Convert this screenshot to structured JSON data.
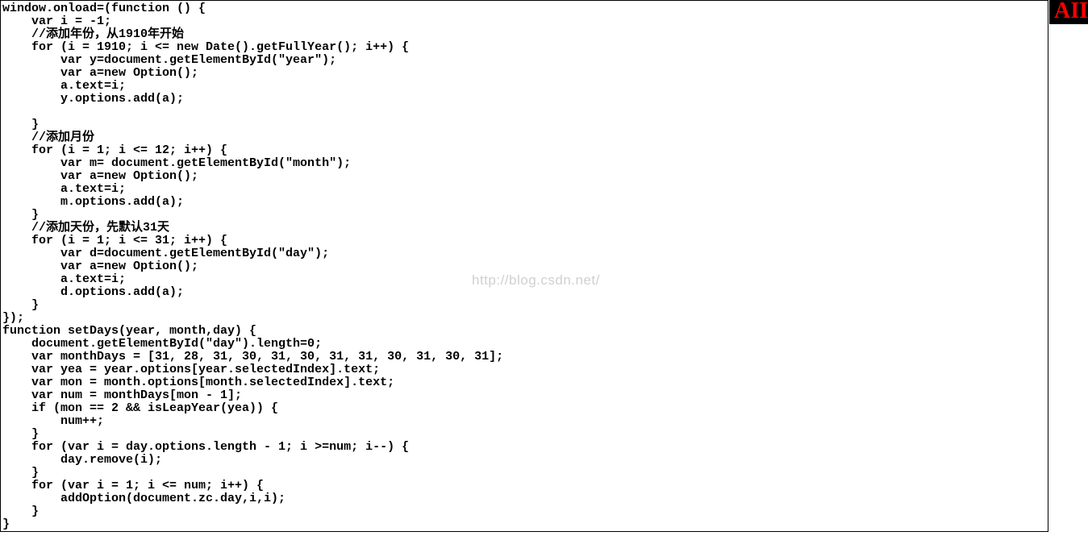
{
  "watermark": "http://blog.csdn.net/",
  "badge": "AII",
  "code": "window.onload=(function () {\n    var i = -1;\n    //添加年份，从1910年开始\n    for (i = 1910; i <= new Date().getFullYear(); i++) {\n        var y=document.getElementById(\"year\");\n        var a=new Option();\n        a.text=i;\n        y.options.add(a);\n\n    }\n    //添加月份\n    for (i = 1; i <= 12; i++) {\n        var m= document.getElementById(\"month\");\n        var a=new Option();\n        a.text=i;\n        m.options.add(a);\n    }\n    //添加天份，先默认31天\n    for (i = 1; i <= 31; i++) {\n        var d=document.getElementById(\"day\");\n        var a=new Option();\n        a.text=i;\n        d.options.add(a);\n    }\n});\nfunction setDays(year, month,day) {\n    document.getElementById(\"day\").length=0;\n    var monthDays = [31, 28, 31, 30, 31, 30, 31, 31, 30, 31, 30, 31];\n    var yea = year.options[year.selectedIndex].text;\n    var mon = month.options[month.selectedIndex].text;\n    var num = monthDays[mon - 1];\n    if (mon == 2 && isLeapYear(yea)) {\n        num++;\n    }\n    for (var i = day.options.length - 1; i >=num; i--) {\n        day.remove(i);\n    }\n    for (var i = 1; i <= num; i++) {\n        addOption(document.zc.day,i,i);\n    }\n}"
}
